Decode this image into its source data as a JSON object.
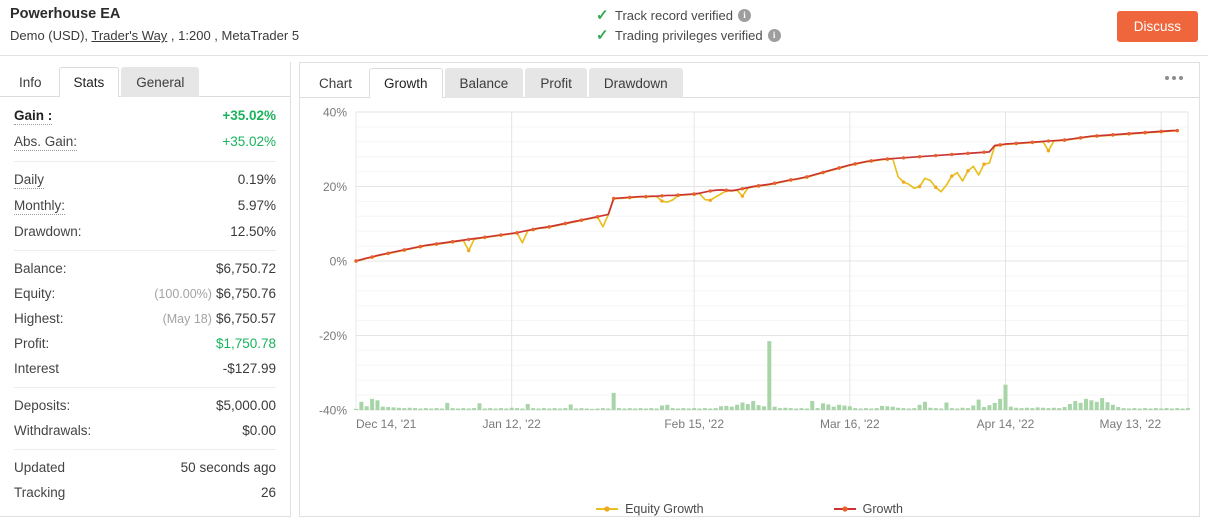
{
  "header": {
    "account_name": "Powerhouse EA",
    "account_meta_prefix": "Demo (USD), ",
    "broker": "Trader's Way",
    "account_meta_suffix": " , 1:200 , MetaTrader 5",
    "verifications": [
      {
        "label": "Track record verified",
        "icon": "check-icon",
        "info": "i"
      },
      {
        "label": "Trading privileges verified",
        "icon": "check-icon",
        "info": "i"
      }
    ],
    "discuss_label": "Discuss",
    "accent_color": "#f0663c",
    "verified_color": "#34a853"
  },
  "sidebar": {
    "tabs": [
      {
        "label": "Info",
        "active": false,
        "style": "plain"
      },
      {
        "label": "Stats",
        "active": true,
        "style": "tab"
      },
      {
        "label": "General",
        "active": false,
        "style": "tab"
      }
    ],
    "groups": [
      {
        "rows": [
          {
            "label": "Gain :",
            "value": "+35.02%",
            "strong": true,
            "value_class": "pos bold",
            "dotted": true
          },
          {
            "label": "Abs. Gain:",
            "value": "+35.02%",
            "value_class": "pos",
            "dotted": true
          }
        ]
      },
      {
        "rows": [
          {
            "label": "Daily",
            "value": "0.19%",
            "dotted": true
          },
          {
            "label": "Monthly:",
            "value": "5.97%",
            "dotted": true
          },
          {
            "label": "Drawdown:",
            "value": "12.50%",
            "dotted": false
          }
        ]
      },
      {
        "rows": [
          {
            "label": "Balance:",
            "value": "$6,750.72",
            "dotted": false
          },
          {
            "label": "Equity:",
            "sub": "(100.00%)",
            "value": "$6,750.76",
            "dotted": false
          },
          {
            "label": "Highest:",
            "sub": "(May 18)",
            "value": "$6,750.57",
            "dotted": false
          },
          {
            "label": "Profit:",
            "value": "$1,750.78",
            "value_class": "pos",
            "dotted": false
          },
          {
            "label": "Interest",
            "value": "-$127.99",
            "dotted": false
          }
        ]
      },
      {
        "rows": [
          {
            "label": "Deposits:",
            "value": "$5,000.00",
            "dotted": false
          },
          {
            "label": "Withdrawals:",
            "value": "$0.00",
            "dotted": false
          }
        ]
      },
      {
        "rows": [
          {
            "label": "Updated",
            "value": "50 seconds ago",
            "dotted": false
          },
          {
            "label": "Tracking",
            "value": "26",
            "dotted": false
          }
        ]
      }
    ]
  },
  "chart_panel": {
    "tabs": [
      {
        "label": "Chart",
        "active": false
      },
      {
        "label": "Growth",
        "active": true
      },
      {
        "label": "Balance",
        "active": false
      },
      {
        "label": "Profit",
        "active": false
      },
      {
        "label": "Drawdown",
        "active": false
      }
    ],
    "more_menu_icon": "ellipsis-icon"
  },
  "chart_data": {
    "type": "line",
    "title": "",
    "xlabel": "",
    "ylabel": "",
    "ylim": [
      -40,
      40
    ],
    "yticks": [
      40,
      20,
      0,
      -20,
      -40
    ],
    "ytick_labels": [
      "40%",
      "20%",
      "0%",
      "-20%",
      "-40%"
    ],
    "grid": true,
    "legend_position": "bottom",
    "xtick_labels": [
      "Dec 14, '21",
      "Jan 12, '22",
      "Feb 15, '22",
      "Mar 16, '22",
      "Apr 14, '22",
      "May 13, '22"
    ],
    "xtick_positions": [
      0,
      29,
      63,
      92,
      121,
      150
    ],
    "x_range": [
      0,
      155
    ],
    "series": [
      {
        "name": "Growth",
        "color": "#cc3333",
        "marker_color": "#e8622b",
        "values": [
          0.0,
          0.4,
          0.8,
          1.1,
          1.5,
          1.8,
          2.1,
          2.4,
          2.7,
          3.0,
          3.3,
          3.6,
          3.9,
          4.2,
          4.4,
          4.6,
          4.8,
          5.0,
          5.2,
          5.4,
          5.6,
          5.8,
          6.0,
          6.2,
          6.4,
          6.6,
          6.8,
          7.0,
          7.2,
          7.4,
          7.6,
          7.9,
          8.2,
          8.5,
          8.8,
          9.0,
          9.2,
          9.5,
          9.8,
          10.1,
          10.4,
          10.7,
          11.0,
          11.3,
          11.6,
          11.9,
          12.2,
          12.5,
          16.8,
          16.9,
          17.0,
          17.1,
          17.2,
          17.3,
          17.3,
          17.4,
          17.4,
          17.5,
          17.6,
          17.6,
          17.7,
          17.8,
          17.9,
          18.0,
          18.2,
          18.5,
          18.8,
          19.0,
          19.1,
          19.0,
          18.9,
          19.1,
          19.4,
          19.7,
          20.0,
          20.2,
          20.4,
          20.6,
          20.9,
          21.2,
          21.5,
          21.8,
          22.0,
          22.3,
          22.6,
          23.0,
          23.4,
          23.8,
          24.2,
          24.6,
          25.0,
          25.4,
          25.8,
          26.1,
          26.4,
          26.7,
          26.9,
          27.1,
          27.3,
          27.4,
          27.5,
          27.6,
          27.7,
          27.8,
          27.9,
          28.0,
          28.1,
          28.2,
          28.3,
          28.4,
          28.5,
          28.6,
          28.7,
          28.8,
          28.9,
          29.0,
          29.1,
          29.2,
          29.3,
          31.0,
          31.2,
          31.4,
          31.5,
          31.6,
          31.7,
          31.8,
          31.9,
          32.0,
          32.1,
          32.2,
          32.3,
          32.4,
          32.5,
          32.7,
          32.9,
          33.1,
          33.3,
          33.5,
          33.6,
          33.7,
          33.8,
          33.9,
          34.0,
          34.1,
          34.2,
          34.3,
          34.4,
          34.5,
          34.6,
          34.7,
          34.8,
          34.9,
          35.0,
          35.02
        ]
      },
      {
        "name": "Equity Growth",
        "color": "#e8c120",
        "marker_color": "#f0a820",
        "values": [
          0.0,
          0.3,
          0.7,
          1.0,
          1.4,
          1.7,
          2.0,
          2.3,
          2.6,
          2.9,
          3.2,
          3.5,
          3.8,
          4.1,
          4.3,
          4.5,
          4.7,
          4.9,
          5.1,
          5.3,
          5.5,
          2.8,
          5.8,
          6.1,
          6.3,
          6.5,
          6.7,
          6.9,
          7.1,
          7.3,
          7.5,
          4.9,
          8.1,
          8.4,
          8.7,
          8.9,
          9.1,
          9.4,
          9.7,
          10.0,
          10.3,
          10.6,
          10.9,
          11.2,
          11.5,
          11.8,
          9.2,
          12.4,
          16.7,
          16.8,
          16.9,
          17.0,
          17.1,
          17.2,
          17.2,
          17.3,
          17.3,
          16.1,
          15.8,
          16.4,
          17.6,
          17.7,
          17.8,
          17.9,
          18.1,
          16.5,
          16.3,
          17.2,
          18.0,
          18.9,
          18.8,
          19.0,
          17.4,
          19.6,
          19.9,
          20.1,
          20.3,
          20.5,
          20.8,
          21.1,
          21.4,
          21.7,
          21.9,
          22.2,
          22.5,
          22.9,
          23.3,
          23.7,
          24.1,
          24.5,
          24.9,
          25.3,
          25.7,
          26.0,
          26.3,
          26.6,
          26.8,
          27.0,
          27.2,
          27.3,
          27.4,
          22.6,
          21.2,
          20.6,
          19.5,
          20.0,
          22.2,
          21.6,
          19.8,
          18.6,
          20.4,
          22.8,
          23.7,
          21.5,
          24.2,
          25.4,
          23.1,
          26.0,
          26.3,
          30.8,
          31.1,
          31.3,
          31.4,
          31.5,
          31.6,
          31.7,
          31.8,
          31.9,
          32.0,
          29.6,
          32.2,
          32.3,
          32.4,
          32.6,
          32.8,
          33.0,
          33.2,
          33.4,
          33.5,
          33.6,
          33.7,
          33.8,
          33.9,
          34.0,
          34.1,
          34.2,
          34.3,
          34.4,
          34.5,
          34.6,
          34.7,
          34.8,
          34.9,
          34.98
        ]
      }
    ],
    "volume_bars": {
      "name": "Volume",
      "color": "#a8d5a8",
      "baseline": -40,
      "values": [
        0.3,
        2.2,
        1.0,
        3.0,
        2.6,
        0.9,
        0.8,
        0.7,
        0.6,
        0.5,
        0.6,
        0.5,
        0.4,
        0.5,
        0.4,
        0.5,
        0.4,
        1.9,
        0.5,
        0.4,
        0.5,
        0.4,
        0.5,
        1.8,
        0.4,
        0.5,
        0.4,
        0.5,
        0.4,
        0.6,
        0.5,
        0.4,
        1.6,
        0.5,
        0.4,
        0.5,
        0.4,
        0.5,
        0.4,
        0.5,
        1.5,
        0.4,
        0.5,
        0.4,
        0.3,
        0.4,
        0.5,
        0.4,
        4.6,
        0.5,
        0.4,
        0.5,
        0.4,
        0.5,
        0.4,
        0.5,
        0.4,
        1.2,
        1.4,
        0.5,
        0.4,
        0.5,
        0.4,
        0.5,
        0.4,
        0.5,
        0.4,
        0.5,
        1.0,
        1.1,
        0.9,
        1.4,
        2.0,
        1.6,
        2.4,
        1.3,
        1.0,
        18.5,
        0.9,
        0.5,
        0.6,
        0.5,
        0.4,
        0.5,
        0.4,
        2.4,
        0.5,
        1.8,
        1.5,
        0.9,
        1.4,
        1.2,
        1.0,
        0.5,
        0.4,
        0.5,
        0.4,
        0.5,
        1.1,
        1.0,
        0.9,
        0.6,
        0.5,
        0.4,
        0.5,
        1.4,
        2.2,
        0.6,
        0.5,
        0.4,
        2.0,
        0.5,
        0.4,
        0.6,
        0.5,
        1.2,
        2.8,
        0.8,
        1.3,
        1.9,
        3.0,
        6.8,
        0.9,
        0.6,
        0.5,
        0.6,
        0.5,
        0.7,
        0.6,
        0.5,
        0.6,
        0.5,
        0.8,
        1.6,
        2.4,
        1.9,
        3.0,
        2.6,
        2.2,
        3.2,
        2.1,
        1.4,
        0.8,
        0.5,
        0.4,
        0.5,
        0.4,
        0.5,
        0.4,
        0.5,
        0.4,
        0.5,
        0.4,
        0.5,
        0.4,
        0.5
      ]
    },
    "legend": [
      {
        "name": "Equity Growth",
        "color": "#e8c120"
      },
      {
        "name": "Growth",
        "color": "#cc3333"
      }
    ]
  }
}
